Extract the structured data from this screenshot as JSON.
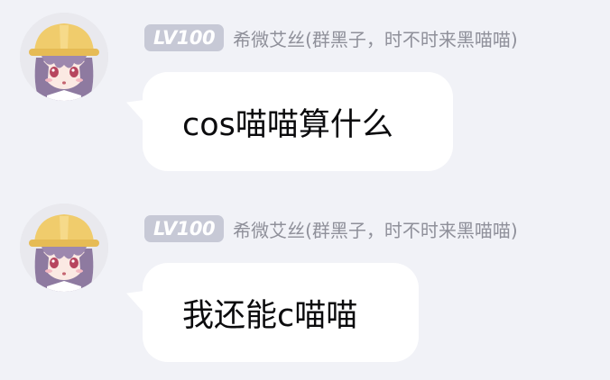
{
  "messages": [
    {
      "level_badge": "LV100",
      "username": "希微艾丝(群黑子，时不时来黑喵喵)",
      "text": "cos喵喵算什么",
      "avatar_icon": "anime-girl-hardhat-avatar"
    },
    {
      "level_badge": "LV100",
      "username": "希微艾丝(群黑子，时不时来黑喵喵)",
      "text": "我还能c喵喵",
      "avatar_icon": "anime-girl-hardhat-avatar"
    }
  ],
  "colors": {
    "background": "#f1f2f7",
    "bubble": "#ffffff",
    "badge": "#c7c9d6",
    "username": "#8f909a",
    "hair": "#8e7aa0",
    "hat": "#f0cc6c"
  }
}
